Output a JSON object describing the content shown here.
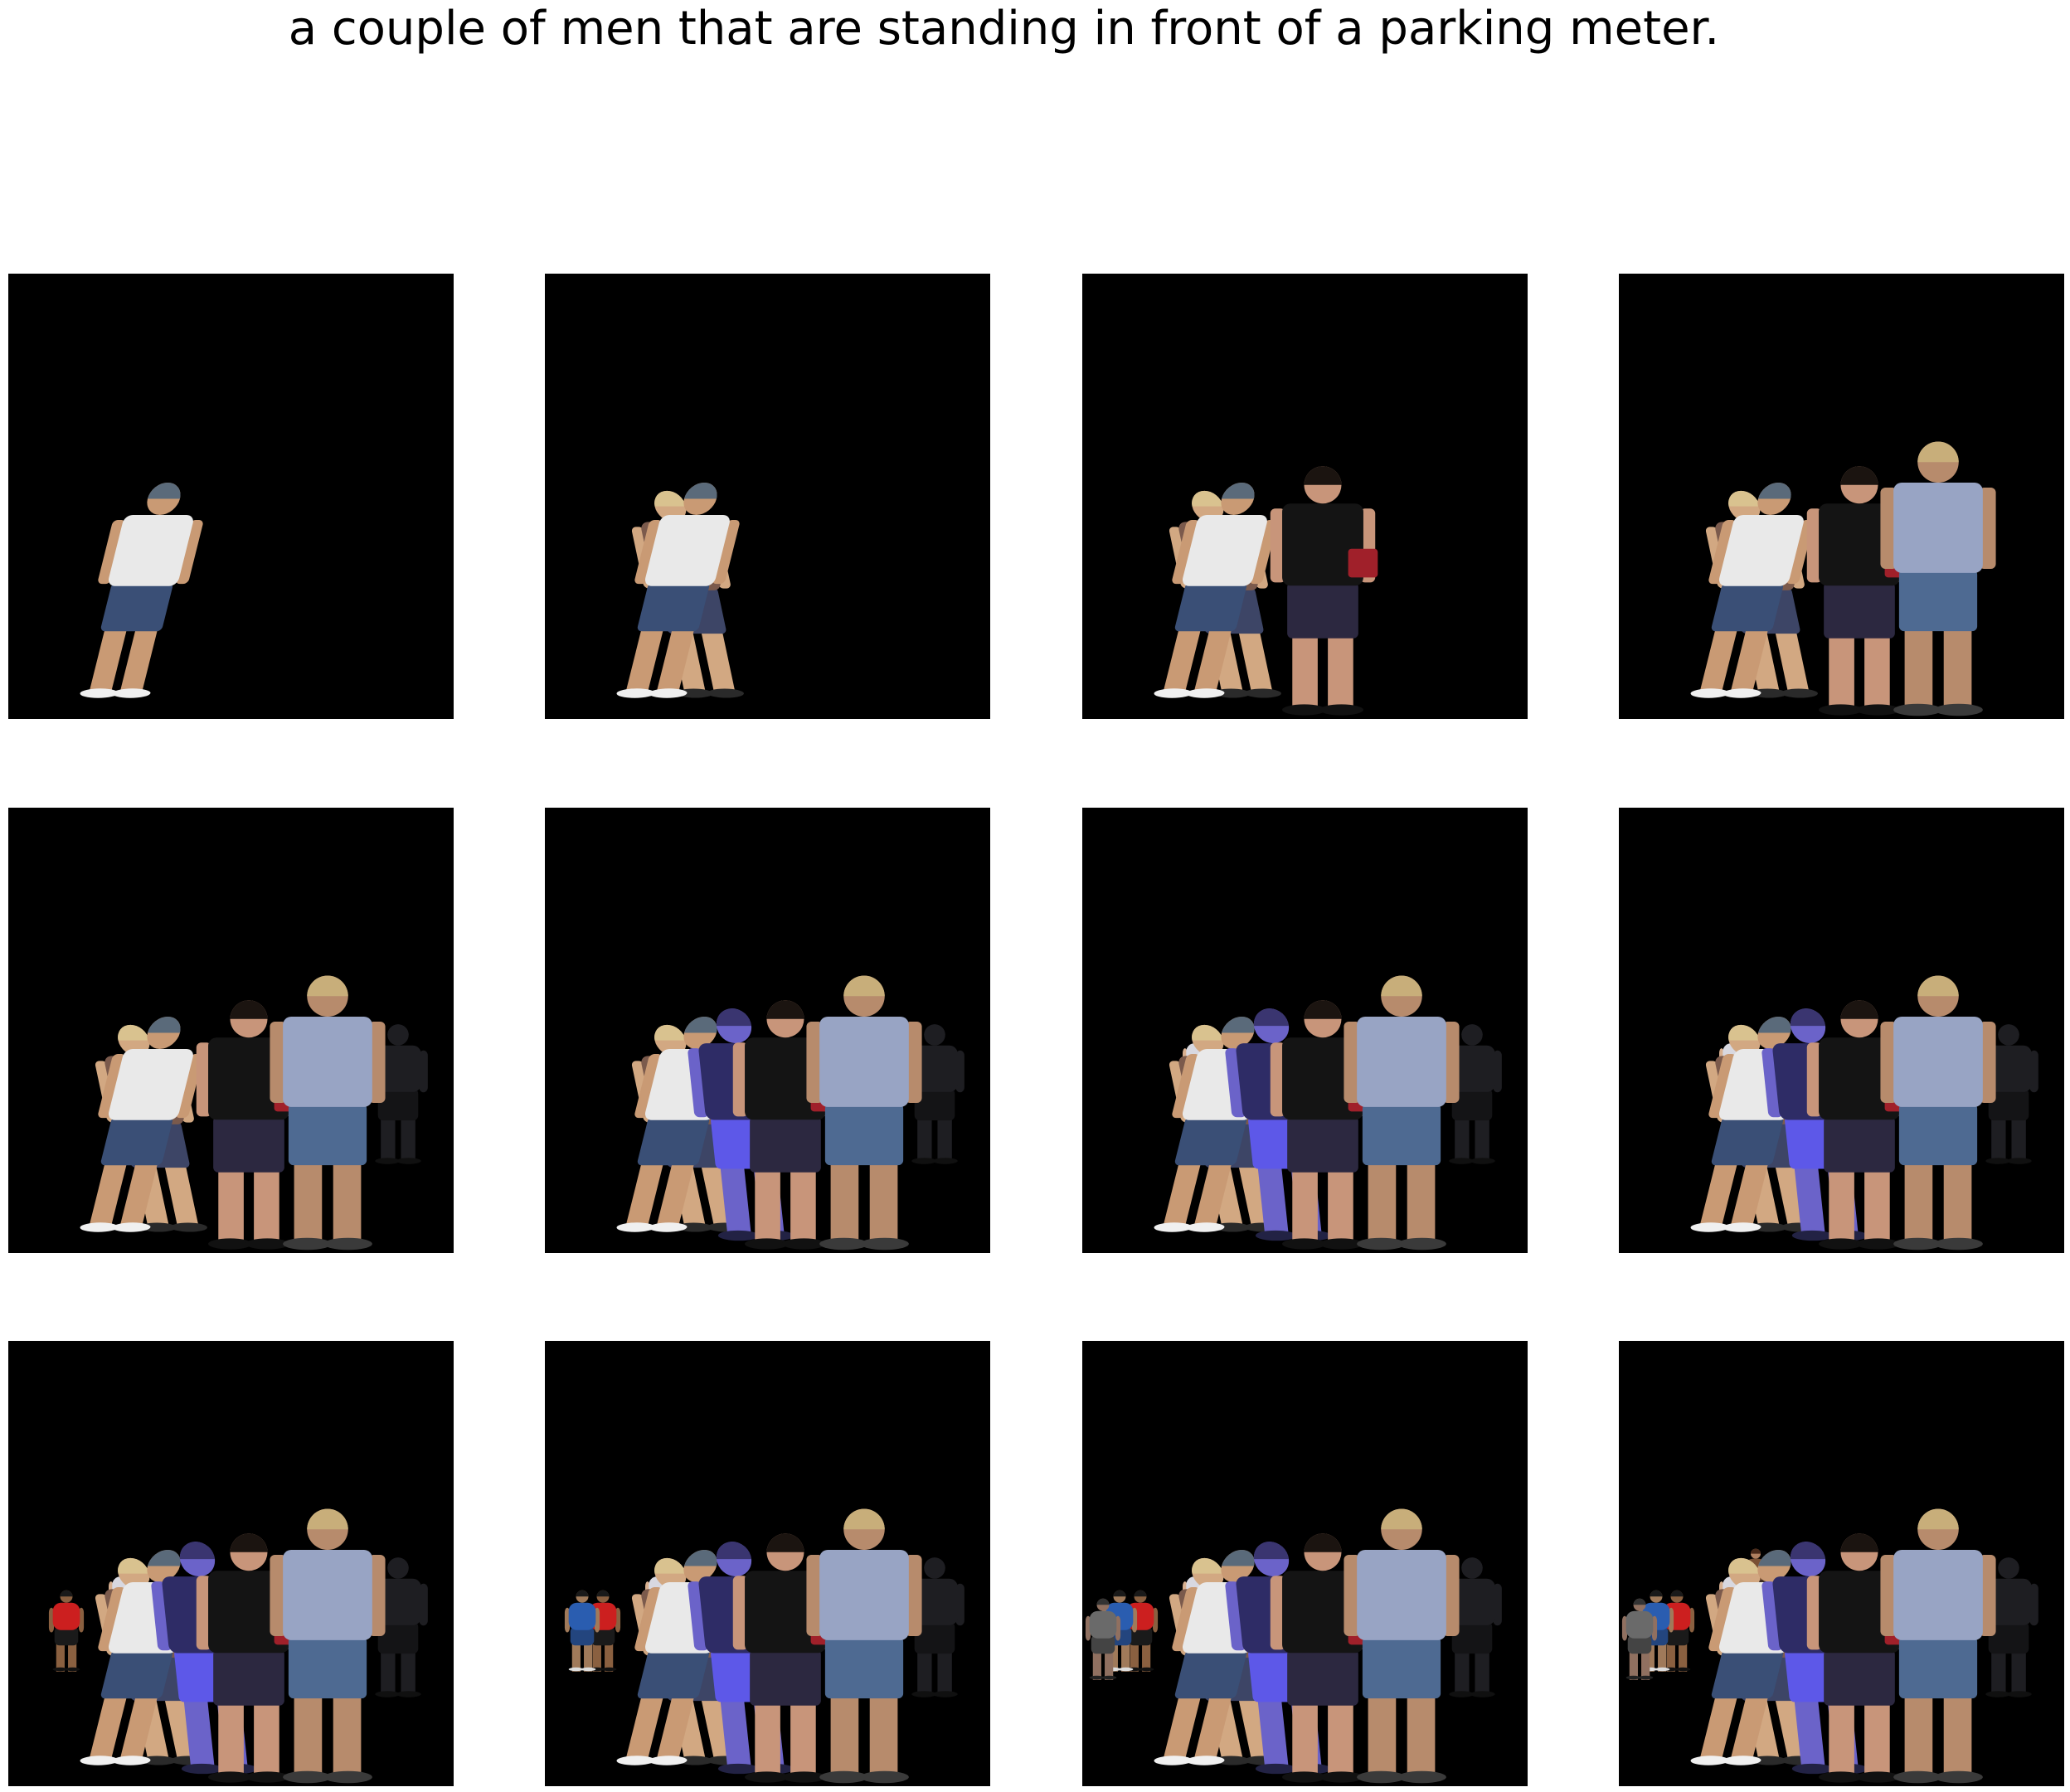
{
  "caption": "a couple of men that are standing in front of a parking meter.",
  "grid": {
    "rows": 3,
    "cols": 4
  },
  "panel_background": "#000000",
  "figure_sequence": [
    "boy-cap",
    "boy-blond",
    "woman-dark",
    "woman-sunglasses",
    "dark-silhouette",
    "man-purple",
    "baby",
    "child-small",
    "person-red",
    "person-blue",
    "person-grey",
    "person-brown"
  ],
  "figures": {
    "boy-cap": {
      "shirt": "#e9e9e9",
      "pants": "#3a4f76",
      "skin": "#c99a74",
      "hair": "#5a6a7a",
      "shoes": "#f0f0f0"
    },
    "boy-blond": {
      "shirt": "#7b5a4c",
      "pants": "#3d4566",
      "skin": "#d2a882",
      "hair": "#d9c28f",
      "shoes": "#2a2a2a"
    },
    "woman-dark": {
      "shirt": "#141414",
      "pants": "#2c2840",
      "skin": "#c8957a",
      "hair": "#1b1410",
      "shoes": "#111111",
      "bag": "#a0202a"
    },
    "woman-sunglasses": {
      "shirt": "#98a4c4",
      "pants": "#4e6a92",
      "skin": "#b78b6c",
      "hair": "#c8ae7a",
      "shoes": "#3a3a3a"
    },
    "dark-silhouette": {
      "shirt": "#1e1e22",
      "pants": "#141416",
      "skin": "#1e1e22",
      "hair": "#1e1e22",
      "shoes": "#101010"
    },
    "man-purple": {
      "shirt": "#2e2c66",
      "pants": "#5d58e8",
      "skin": "#6b63c9",
      "hair": "#3a3570",
      "shoes": "#222244"
    },
    "baby": {
      "shirt": "#d8d8e0",
      "pants": "#4a5a8a",
      "skin": "#d8b090",
      "hair": "#3a2a22",
      "shoes": "#d0d0d0"
    },
    "child-small": {
      "shirt": "#c89078",
      "pants": "#8a6a5a",
      "skin": "#d0a080",
      "hair": "#3a2a22",
      "shoes": "#aaaaaa"
    },
    "person-red": {
      "shirt": "#cc1f1f",
      "pants": "#1a1a1a",
      "skin": "#8a6040",
      "hair": "#1a1a1a",
      "shoes": "#111111"
    },
    "person-blue": {
      "shirt": "#2a5db0",
      "pants": "#23457e",
      "skin": "#a07a5a",
      "hair": "#1a1a1a",
      "shoes": "#dddddd"
    },
    "person-grey": {
      "shirt": "#6a6a6a",
      "pants": "#444444",
      "skin": "#907060",
      "hair": "#333333",
      "shoes": "#222222"
    },
    "person-brown": {
      "shirt": "#7a5034",
      "pants": "#3a2a22",
      "skin": "#b08060",
      "hair": "#4a2a1a",
      "shoes": "#222222"
    }
  },
  "panels": [
    {
      "index": 1,
      "figure_count": 1
    },
    {
      "index": 2,
      "figure_count": 2
    },
    {
      "index": 3,
      "figure_count": 3
    },
    {
      "index": 4,
      "figure_count": 4
    },
    {
      "index": 5,
      "figure_count": 5
    },
    {
      "index": 6,
      "figure_count": 6
    },
    {
      "index": 7,
      "figure_count": 7
    },
    {
      "index": 8,
      "figure_count": 8
    },
    {
      "index": 9,
      "figure_count": 9
    },
    {
      "index": 10,
      "figure_count": 10
    },
    {
      "index": 11,
      "figure_count": 11
    },
    {
      "index": 12,
      "figure_count": 12
    }
  ]
}
